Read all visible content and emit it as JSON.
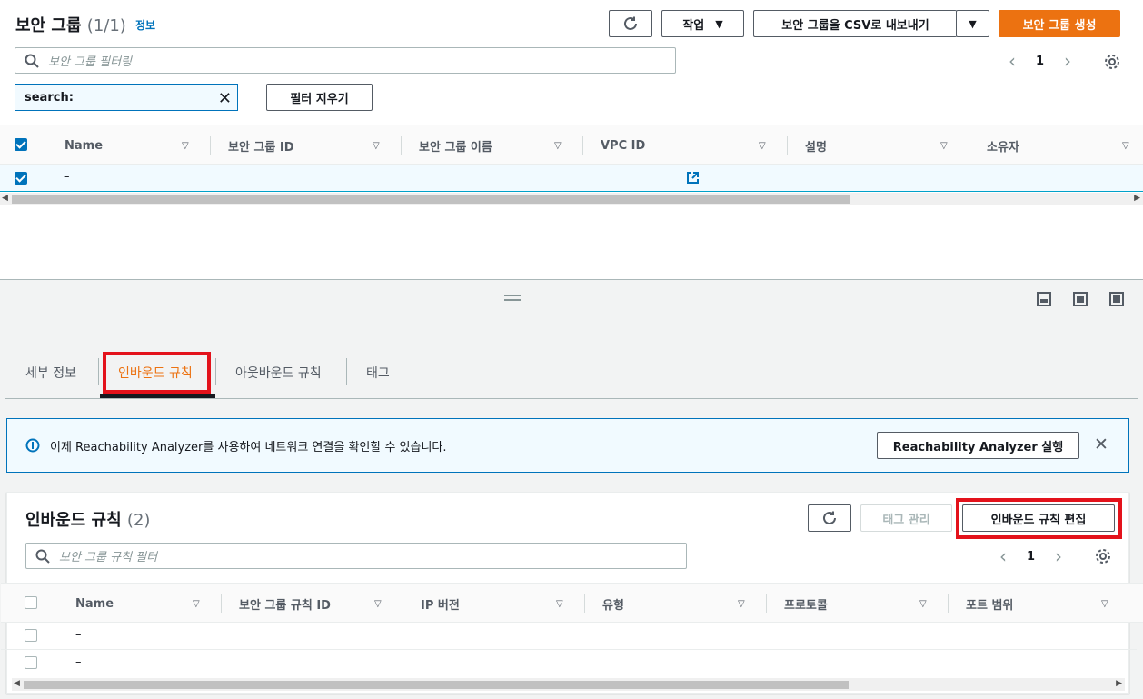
{
  "header": {
    "title": "보안 그룹",
    "count": "(1/1)",
    "info_link": "정보"
  },
  "toolbar": {
    "actions_label": "작업",
    "export_label": "보안 그룹을 CSV로 내보내기",
    "create_label": "보안 그룹 생성"
  },
  "filter": {
    "placeholder": "보안 그룹 필터링",
    "token_text": "search:",
    "clear_label": "필터 지우기"
  },
  "pager_top": {
    "page": "1"
  },
  "table1": {
    "columns": [
      "Name",
      "보안 그룹 ID",
      "보안 그룹 이름",
      "VPC ID",
      "설명",
      "소유자"
    ],
    "rows": [
      {
        "name": "–"
      }
    ]
  },
  "tabs": [
    {
      "label": "세부 정보",
      "active": false
    },
    {
      "label": "인바운드 규칙",
      "active": true
    },
    {
      "label": "아웃바운드 규칙",
      "active": false
    },
    {
      "label": "태그",
      "active": false
    }
  ],
  "alert": {
    "message": "이제 Reachability Analyzer를 사용하여 네트워크 연결을 확인할 수 있습니다.",
    "button_label": "Reachability Analyzer 실행"
  },
  "inbound": {
    "title": "인바운드 규칙",
    "count": "(2)",
    "manage_tags_label": "태그 관리",
    "edit_label": "인바운드 규칙 편집",
    "filter_placeholder": "보안 그룹 규칙 필터",
    "page": "1",
    "columns": [
      "Name",
      "보안 그룹 규칙 ID",
      "IP 버전",
      "유형",
      "프로토콜",
      "포트 범위"
    ],
    "rows": [
      {
        "name": "–"
      },
      {
        "name": "–"
      }
    ]
  },
  "colors": {
    "accent": "#ec7211",
    "link": "#0073bb",
    "highlight": "#e3121b"
  }
}
